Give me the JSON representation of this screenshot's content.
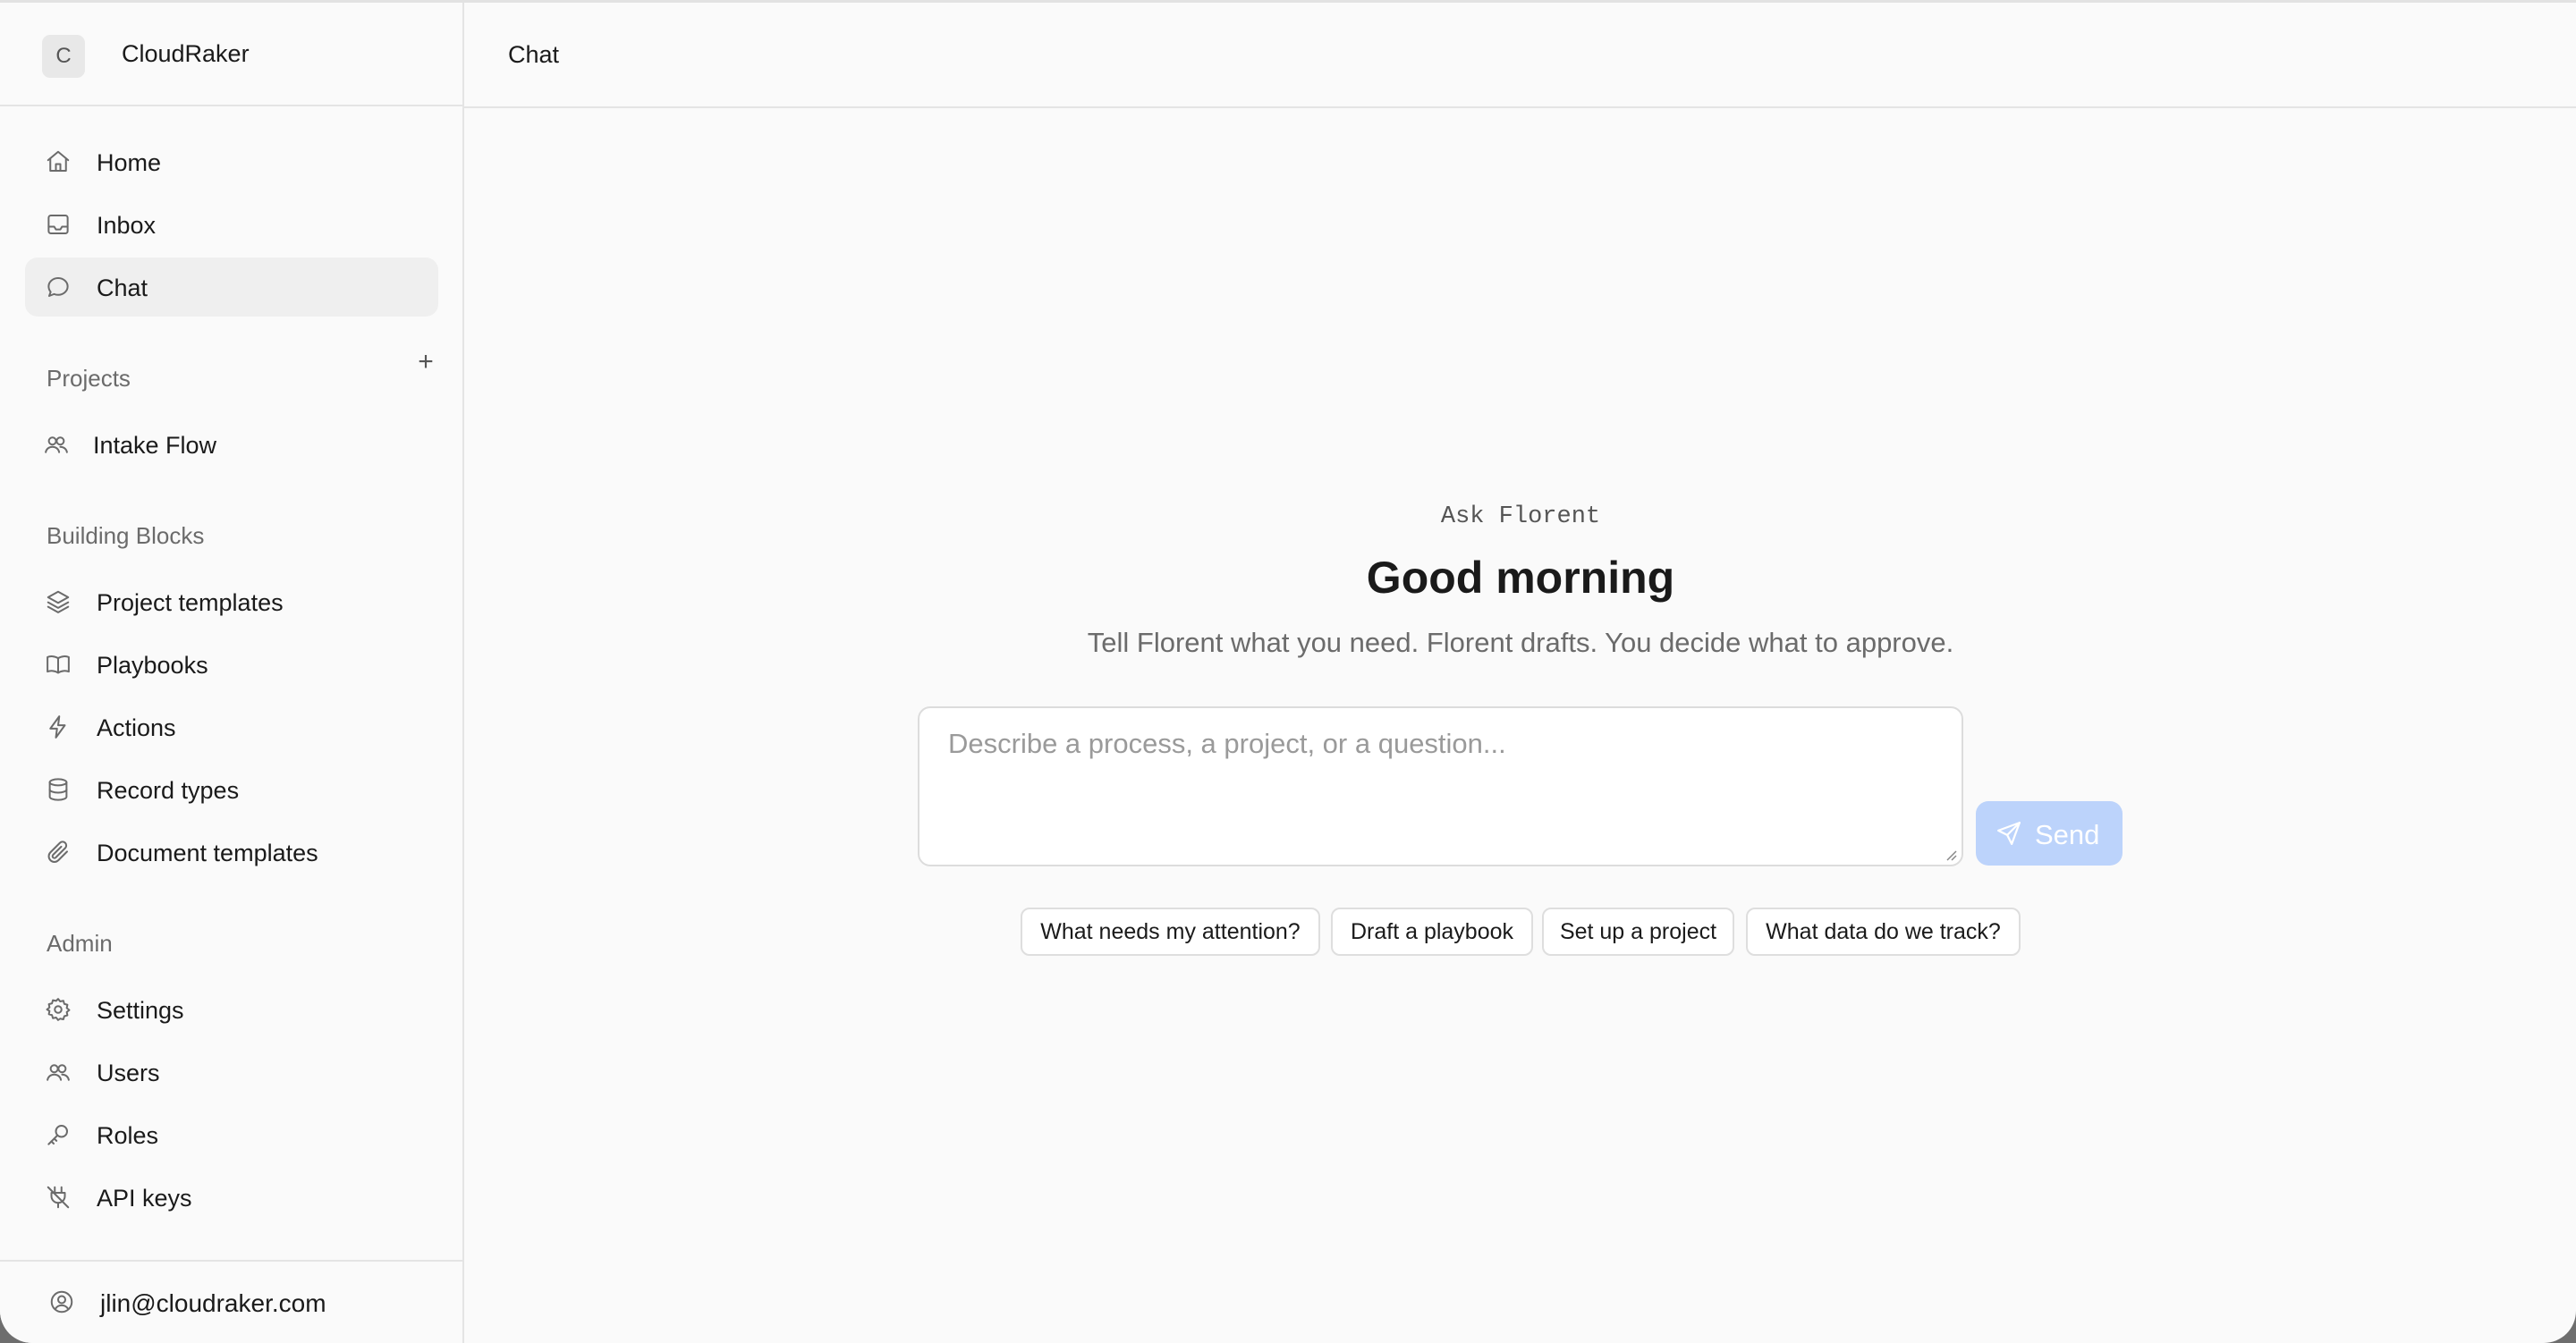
{
  "brand": {
    "initial": "C",
    "name": "CloudRaker"
  },
  "nav": [
    {
      "label": "Home",
      "icon": "home-icon"
    },
    {
      "label": "Inbox",
      "icon": "inbox-icon"
    },
    {
      "label": "Chat",
      "icon": "chat-icon",
      "active": true
    }
  ],
  "projects": {
    "title": "Projects",
    "add_label": "+",
    "items": [
      {
        "label": "Intake Flow",
        "icon": "users-icon"
      }
    ]
  },
  "building_blocks": {
    "title": "Building Blocks",
    "items": [
      {
        "label": "Project templates",
        "icon": "layers-icon"
      },
      {
        "label": "Playbooks",
        "icon": "book-icon"
      },
      {
        "label": "Actions",
        "icon": "lightning-icon"
      },
      {
        "label": "Record types",
        "icon": "database-icon"
      },
      {
        "label": "Document templates",
        "icon": "paperclip-icon"
      }
    ]
  },
  "admin": {
    "title": "Admin",
    "items": [
      {
        "label": "Settings",
        "icon": "gear-icon"
      },
      {
        "label": "Users",
        "icon": "users-icon"
      },
      {
        "label": "Roles",
        "icon": "key-icon"
      },
      {
        "label": "API keys",
        "icon": "plug-icon"
      }
    ]
  },
  "footer": {
    "email": "jlin@cloudraker.com",
    "icon": "user-circle-icon"
  },
  "header": {
    "title": "Chat"
  },
  "hero": {
    "kicker": "Ask Florent",
    "title": "Good morning",
    "subtitle": "Tell Florent what you need. Florent drafts. You decide what to approve."
  },
  "composer": {
    "placeholder": "Describe a process, a project, or a question...",
    "value": "",
    "send_label": "Send"
  },
  "suggestions": [
    "What needs my attention?",
    "Draft a playbook",
    "Set up a project",
    "What data do we track?"
  ],
  "colors": {
    "send_button": "#bcd3fb",
    "active_nav": "#efefef",
    "background": "#fafafa"
  }
}
